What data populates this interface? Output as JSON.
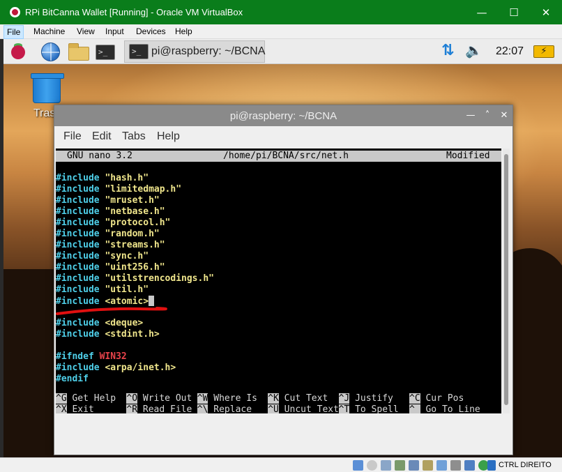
{
  "vbox": {
    "title": "RPi BitCanna Wallet [Running] - Oracle VM VirtualBox",
    "controls": {
      "minimize": "—",
      "maximize": "☐",
      "close": "✕"
    },
    "menu": [
      "File",
      "Machine",
      "View",
      "Input",
      "Devices",
      "Help"
    ],
    "status": {
      "host_key": "CTRL DIREITO"
    }
  },
  "panel": {
    "task_label": "pi@raspberry: ~/BCNA",
    "clock": "22:07",
    "icons": {
      "launcher": "raspberry-menu-icon",
      "browser": "globe-icon",
      "files": "folder-icon",
      "terminal": "terminal-icon",
      "network": "network-arrows-icon",
      "volume": "volume-icon",
      "power": "battery-power-icon"
    },
    "term_prompt_glyph": ">_"
  },
  "desktop": {
    "trash_label": "Trash"
  },
  "terminal": {
    "title": "pi@raspberry: ~/BCNA",
    "menu": [
      "File",
      "Edit",
      "Tabs",
      "Help"
    ],
    "titlebar_buttons": {
      "minimize": "—",
      "maximize": "˄",
      "close": "✕"
    }
  },
  "nano": {
    "version": "GNU nano 3.2",
    "path": "/home/pi/BCNA/src/net.h",
    "status": "Modified",
    "lines": [
      {
        "directive": "",
        "arg": ""
      },
      {
        "directive": "#include",
        "arg": "\"hash.h\""
      },
      {
        "directive": "#include",
        "arg": "\"limitedmap.h\""
      },
      {
        "directive": "#include",
        "arg": "\"mruset.h\""
      },
      {
        "directive": "#include",
        "arg": "\"netbase.h\""
      },
      {
        "directive": "#include",
        "arg": "\"protocol.h\""
      },
      {
        "directive": "#include",
        "arg": "\"random.h\""
      },
      {
        "directive": "#include",
        "arg": "\"streams.h\""
      },
      {
        "directive": "#include",
        "arg": "\"sync.h\""
      },
      {
        "directive": "#include",
        "arg": "\"uint256.h\""
      },
      {
        "directive": "#include",
        "arg": "\"utilstrencodings.h\""
      },
      {
        "directive": "#include",
        "arg": "\"util.h\""
      },
      {
        "directive": "#include",
        "arg": "<atomic>",
        "cursor": true,
        "underlined": true
      },
      {
        "directive": "",
        "arg": ""
      },
      {
        "directive": "#include",
        "arg": "<deque>"
      },
      {
        "directive": "#include",
        "arg": "<stdint.h>"
      },
      {
        "directive": "",
        "arg": ""
      },
      {
        "directive": "#ifndef",
        "arg": "WIN32",
        "arg_style": "red"
      },
      {
        "directive": "#include",
        "arg": "<arpa/inet.h>"
      },
      {
        "directive": "#endif",
        "arg": ""
      }
    ],
    "shortcuts": [
      [
        {
          "key": "^G",
          "label": "Get Help"
        },
        {
          "key": "^O",
          "label": "Write Out"
        },
        {
          "key": "^W",
          "label": "Where Is"
        },
        {
          "key": "^K",
          "label": "Cut Text"
        },
        {
          "key": "^J",
          "label": "Justify"
        },
        {
          "key": "^C",
          "label": "Cur Pos"
        }
      ],
      [
        {
          "key": "^X",
          "label": "Exit"
        },
        {
          "key": "^R",
          "label": "Read File"
        },
        {
          "key": "^\\",
          "label": "Replace"
        },
        {
          "key": "^U",
          "label": "Uncut Text"
        },
        {
          "key": "^T",
          "label": "To Spell"
        },
        {
          "key": "^_",
          "label": "Go To Line"
        }
      ]
    ]
  },
  "colors": {
    "vbox_titlebar": "#0a7d1b",
    "nano_directive": "#4fd0ea",
    "nano_string": "#f0e68c",
    "nano_macro": "#e8434a",
    "annotation_underline": "#e01010"
  }
}
